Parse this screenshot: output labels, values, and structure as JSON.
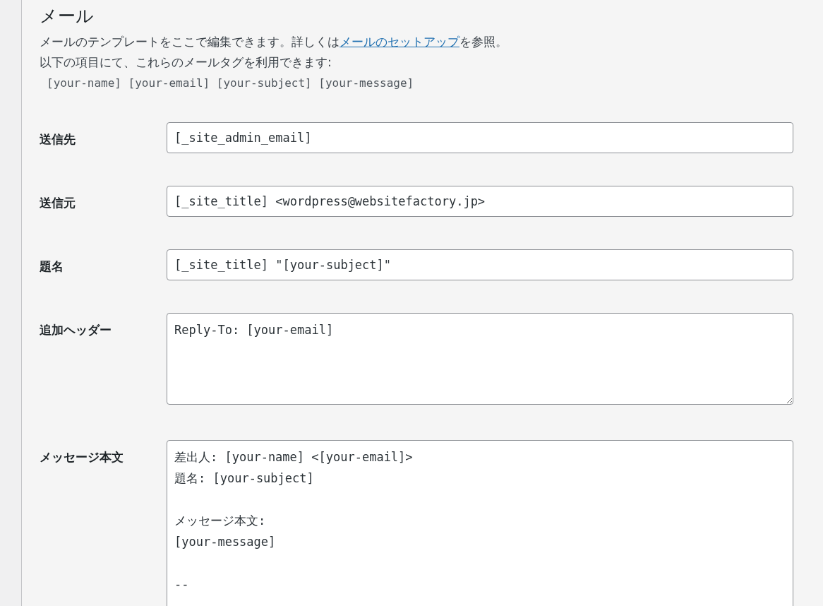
{
  "section": {
    "title": "メール",
    "description": "メールのテンプレートをここで編集できます。詳しくは",
    "link": "メールのセットアップ",
    "description_end": "を参照。",
    "tags_intro": "以下の項目にて、これらのメールタグを利用できます:",
    "tags": "[your-name] [your-email] [your-subject] [your-message]"
  },
  "fields": [
    {
      "kind": "input",
      "label": "送信先",
      "value": "[_site_admin_email]"
    },
    {
      "kind": "input",
      "label": "送信元",
      "value": "[_site_title] <wordpress@websitefactory.jp>"
    },
    {
      "kind": "input",
      "label": "題名",
      "value": "[_site_title] \"[your-subject]\""
    },
    {
      "kind": "textarea",
      "label": "追加ヘッダー",
      "value": "Reply-To: [your-email]"
    },
    {
      "kind": "message",
      "label": "メッセージ本文",
      "value": "差出人: [your-name] <[your-email]>\n題名: [your-subject]\n\nメッセージ本文:\n[your-message]\n\n--"
    }
  ]
}
